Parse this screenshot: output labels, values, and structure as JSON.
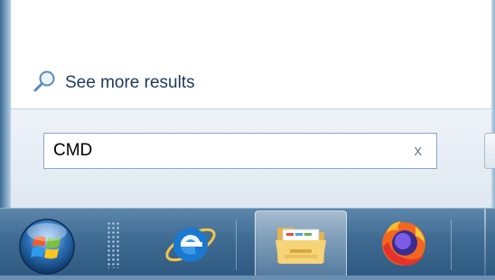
{
  "start_menu": {
    "see_more_label": "See more results",
    "search": {
      "value": "CMD",
      "clear_glyph": "x"
    }
  },
  "taskbar": {
    "start_button": "windows-orb-icon",
    "pinned": [
      {
        "name": "internet-explorer",
        "icon": "internet-explorer-icon"
      },
      {
        "name": "windows-explorer",
        "icon": "folder-icon"
      },
      {
        "name": "firefox",
        "icon": "firefox-icon"
      }
    ]
  },
  "colors": {
    "link_text": "#1e395b",
    "taskbar": "#3f6b93",
    "ie_blue": "#1b78d0",
    "firefox_orange": "#f2671f"
  }
}
